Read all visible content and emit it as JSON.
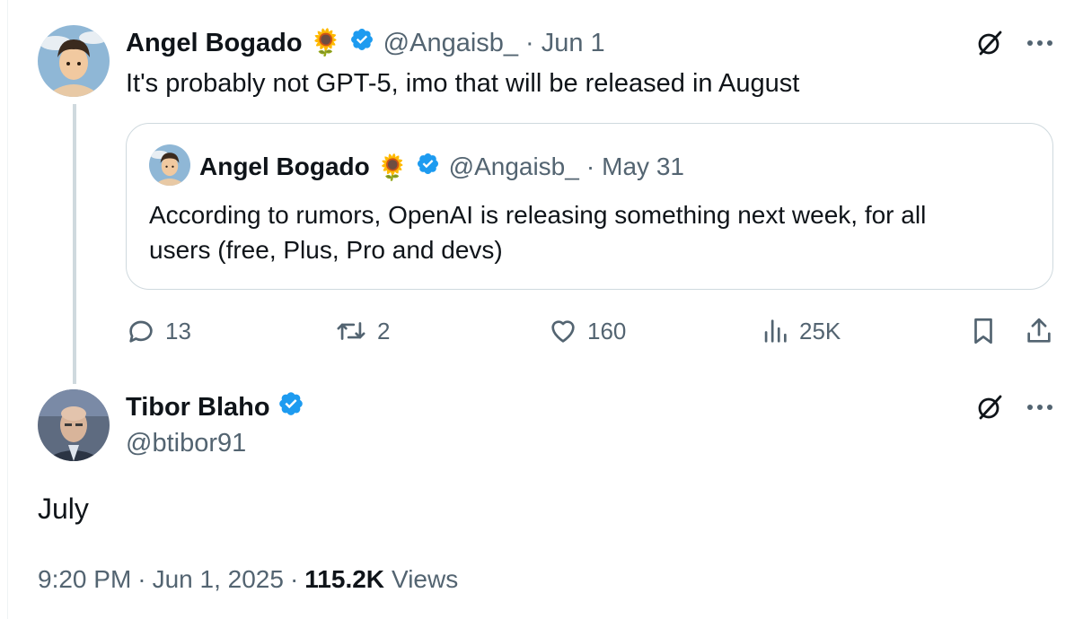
{
  "parent": {
    "author_name": "Angel Bogado",
    "author_emoji": "🌻",
    "handle": "@Angaisb_",
    "separator": "·",
    "date": "Jun 1",
    "text": "It's probably not GPT-5, imo that will be released in August",
    "quoted": {
      "author_name": "Angel Bogado",
      "author_emoji": "🌻",
      "handle": "@Angaisb_",
      "separator": "·",
      "date": "May 31",
      "text_line1": "According to rumors, OpenAI is releasing something next week, for all",
      "text_line2": "users (free, Plus, Pro and devs)"
    },
    "actions": {
      "replies": "13",
      "reposts": "2",
      "likes": "160",
      "views": "25K"
    }
  },
  "main": {
    "author_name": "Tibor Blaho",
    "handle": "@btibor91",
    "text": "July",
    "time": "9:20 PM",
    "separator": "·",
    "date": "Jun 1, 2025",
    "views_count": "115.2K",
    "views_label": "Views"
  },
  "colors": {
    "verified": "#1d9bf0",
    "muted": "#536471",
    "text": "#0f1419",
    "border": "#cfd9de"
  },
  "icons": [
    "verified-badge-icon",
    "grok-icon",
    "more-icon",
    "reply-icon",
    "repost-icon",
    "like-icon",
    "views-icon",
    "bookmark-icon",
    "share-icon"
  ]
}
